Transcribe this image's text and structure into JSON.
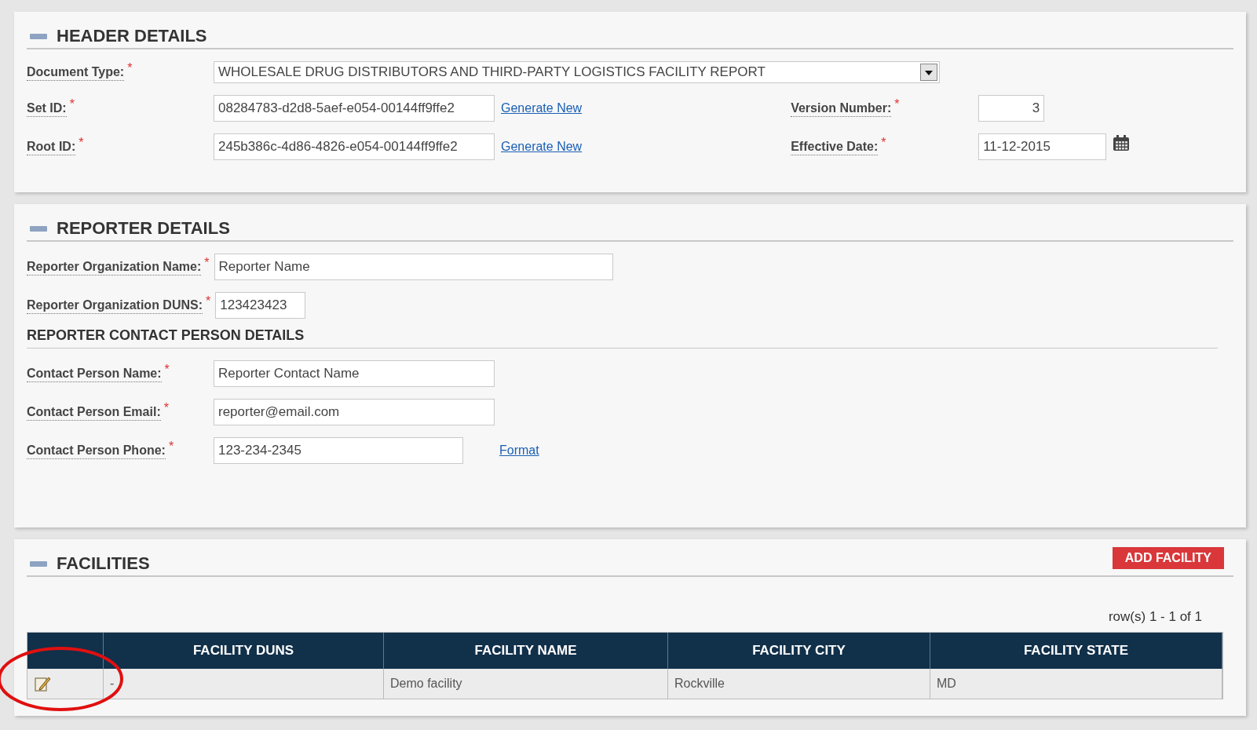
{
  "header_details": {
    "title": "HEADER DETAILS",
    "document_type": {
      "label": "Document Type:",
      "marker": "*",
      "value": "WHOLESALE DRUG DISTRIBUTORS AND THIRD-PARTY LOGISTICS FACILITY REPORT"
    },
    "set_id": {
      "label": "Set ID:",
      "marker": "*",
      "value": "08284783-d2d8-5aef-e054-00144ff9ffe2",
      "link": "Generate New"
    },
    "root_id": {
      "label": "Root ID:",
      "marker": "*",
      "value": "245b386c-4d86-4826-e054-00144ff9ffe2",
      "link": "Generate New"
    },
    "version_number": {
      "label": "Version Number:",
      "marker": "*",
      "value": "3"
    },
    "effective_date": {
      "label": "Effective Date:",
      "marker": "*",
      "value": "11-12-2015"
    }
  },
  "reporter_details": {
    "title": "REPORTER DETAILS",
    "organization_name": {
      "label": "Reporter Organization Name:",
      "marker": "*",
      "value": "Reporter Name"
    },
    "organization_duns": {
      "label": "Reporter Organization DUNS:",
      "marker": "*",
      "value": "123423423"
    },
    "contact_title": "REPORTER CONTACT PERSON DETAILS",
    "contact_name": {
      "label": "Contact Person Name:",
      "marker": "*",
      "value": "Reporter Contact Name"
    },
    "contact_email": {
      "label": "Contact Person Email:",
      "marker": "*",
      "value": "reporter@email.com"
    },
    "contact_phone": {
      "label": "Contact Person Phone:",
      "marker": "*",
      "value": "123-234-2345",
      "link": "Format"
    }
  },
  "facilities": {
    "title": "FACILITIES",
    "add_button": "ADD FACILITY",
    "row_count": "row(s) 1 - 1 of 1",
    "table": {
      "columns": [
        "FACILITY DUNS",
        "FACILITY NAME",
        "FACILITY CITY",
        "FACILITY STATE"
      ],
      "rows": [
        {
          "cells": [
            "-",
            "Demo facility",
            "Rockville",
            "MD"
          ],
          "highlighted": true
        }
      ]
    }
  }
}
